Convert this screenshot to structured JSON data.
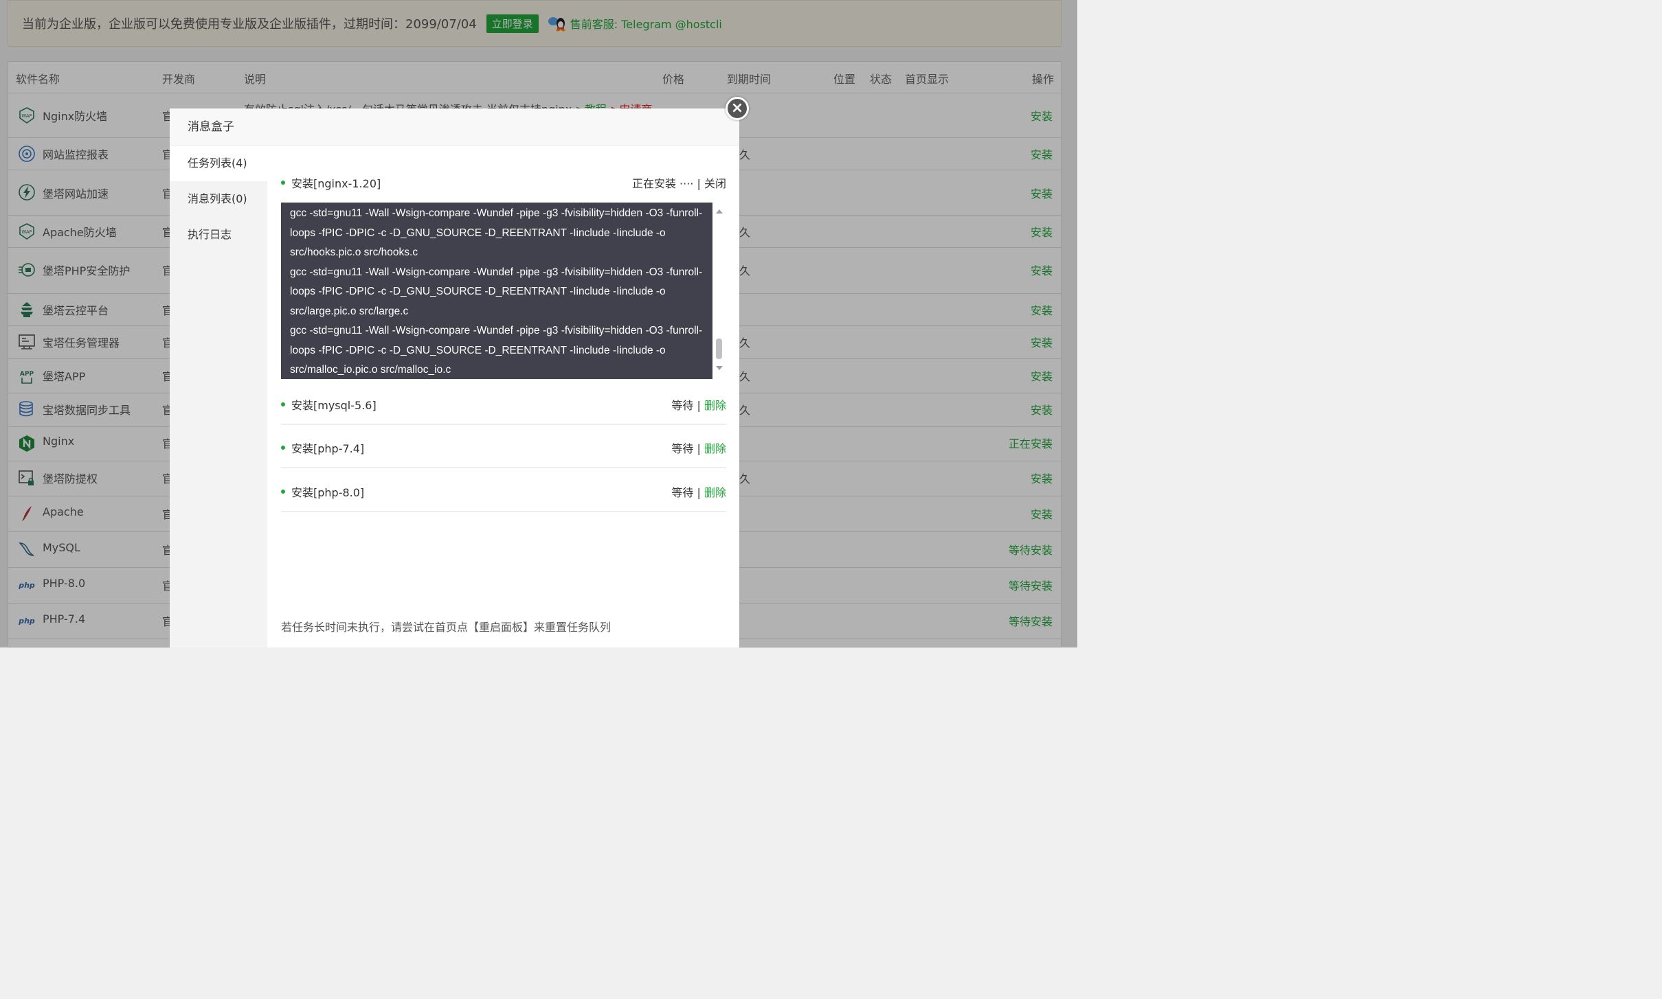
{
  "notice": {
    "text": "当前为企业版，企业版可以免费使用专业版及企业版插件，过期时间：2099/07/04",
    "login_btn": "立即登录",
    "customer_service": "售前客服: Telegram @hostcli"
  },
  "table": {
    "headers": {
      "name": "软件名称",
      "developer": "开发商",
      "desc": "说明",
      "price": "价格",
      "expire": "到期时间",
      "position": "位置",
      "status": "状态",
      "home_show": "首页显示",
      "action": "操作"
    },
    "first_desc": "有效防止sql注入/xss/一句话木马等常见渗透攻击,当前仅支持nginx",
    "first_tutorial": ">教程",
    "first_apply": ">申请商",
    "rows": [
      {
        "name": "Nginx防火墙",
        "dev": "官",
        "exp": "",
        "action": "安装"
      },
      {
        "name": "网站监控报表",
        "dev": "官",
        "exp": "久",
        "action": "安装"
      },
      {
        "name": "堡塔网站加速",
        "dev": "官",
        "exp": "",
        "action": "安装"
      },
      {
        "name": "Apache防火墙",
        "dev": "官",
        "exp": "久",
        "action": "安装"
      },
      {
        "name": "堡塔PHP安全防护",
        "dev": "官",
        "exp": "久",
        "action": "安装"
      },
      {
        "name": "堡塔云控平台",
        "dev": "官",
        "exp": "",
        "action": "安装"
      },
      {
        "name": "宝塔任务管理器",
        "dev": "官",
        "exp": "久",
        "action": "安装"
      },
      {
        "name": "堡塔APP",
        "dev": "官",
        "exp": "久",
        "action": "安装"
      },
      {
        "name": "宝塔数据同步工具",
        "dev": "官",
        "exp": "久",
        "action": "安装"
      },
      {
        "name": "Nginx",
        "dev": "官",
        "exp": "",
        "action": "正在安装"
      },
      {
        "name": "堡塔防提权",
        "dev": "官",
        "exp": "久",
        "action": "安装"
      },
      {
        "name": "Apache",
        "dev": "官",
        "exp": "",
        "action": "安装"
      },
      {
        "name": "MySQL",
        "dev": "官",
        "exp": "",
        "action": "等待安装"
      },
      {
        "name": "PHP-8.0",
        "dev": "官",
        "exp": "",
        "action": "等待安装"
      },
      {
        "name": "PHP-7.4",
        "dev": "官",
        "exp": "",
        "action": "等待安装"
      }
    ]
  },
  "modal": {
    "title": "消息盒子",
    "tabs": [
      "任务列表(4)",
      "消息列表(0)",
      "执行日志"
    ],
    "tasks": [
      {
        "name": "安装[nginx-1.20]",
        "status": "正在安装 ····",
        "sep": "|",
        "action": "关闭"
      },
      {
        "name": "安装[mysql-5.6]",
        "status": "等待",
        "sep": "|",
        "action": "删除"
      },
      {
        "name": "安装[php-7.4]",
        "status": "等待",
        "sep": "|",
        "action": "删除"
      },
      {
        "name": "安装[php-8.0]",
        "status": "等待",
        "sep": "|",
        "action": "删除"
      }
    ],
    "log_lines": [
      "gcc -std=gnu11 -Wall -Wsign-compare -Wundef -pipe -g3 -fvisibility=hidden -O3 -funroll-loops -fPIC -DPIC -c -D_GNU_SOURCE -D_REENTRANT -Iinclude -Iinclude -o src/hooks.pic.o src/hooks.c",
      "gcc -std=gnu11 -Wall -Wsign-compare -Wundef -pipe -g3 -fvisibility=hidden -O3 -funroll-loops -fPIC -DPIC -c -D_GNU_SOURCE -D_REENTRANT -Iinclude -Iinclude -o src/large.pic.o src/large.c",
      "gcc -std=gnu11 -Wall -Wsign-compare -Wundef -pipe -g3 -fvisibility=hidden -O3 -funroll-loops -fPIC -DPIC -c -D_GNU_SOURCE -D_REENTRANT -Iinclude -Iinclude -o src/malloc_io.pic.o src/malloc_io.c"
    ],
    "tip": "若任务长时间未执行，请尝试在首页点【重启面板】来重置任务队列",
    "close_symbol": "×"
  },
  "colors": {
    "accent": "#20a53a",
    "log_bg": "#41404d",
    "red": "#e02020"
  }
}
